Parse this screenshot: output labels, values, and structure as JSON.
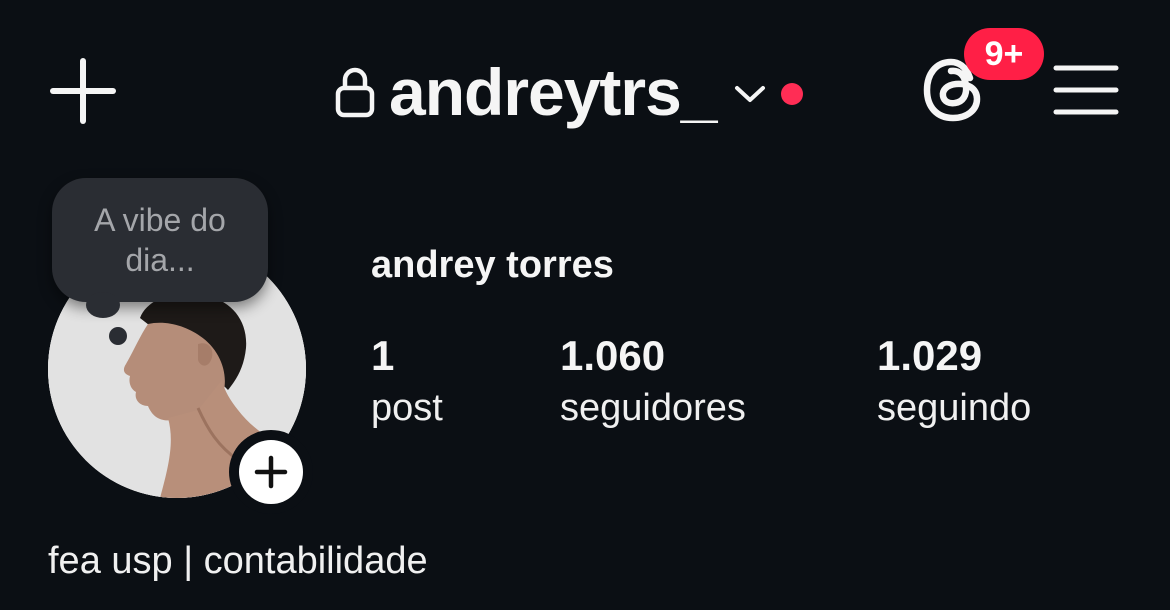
{
  "header": {
    "username": "andreytrs_",
    "notification_badge": "9+",
    "accent_color": "#ff1f46"
  },
  "icons": {
    "new": "plus-icon",
    "lock": "lock-icon",
    "chevron": "chevron-down-icon",
    "threads": "threads-icon",
    "menu": "hamburger-menu-icon",
    "add_story": "plus-icon"
  },
  "note": {
    "text": "A vibe do dia..."
  },
  "profile": {
    "full_name": "andrey torres",
    "bio": "fea usp | contabilidade",
    "stats": {
      "posts": {
        "value": "1",
        "label": "post"
      },
      "followers": {
        "value": "1.060",
        "label": "seguidores"
      },
      "following": {
        "value": "1.029",
        "label": "seguindo"
      }
    }
  }
}
